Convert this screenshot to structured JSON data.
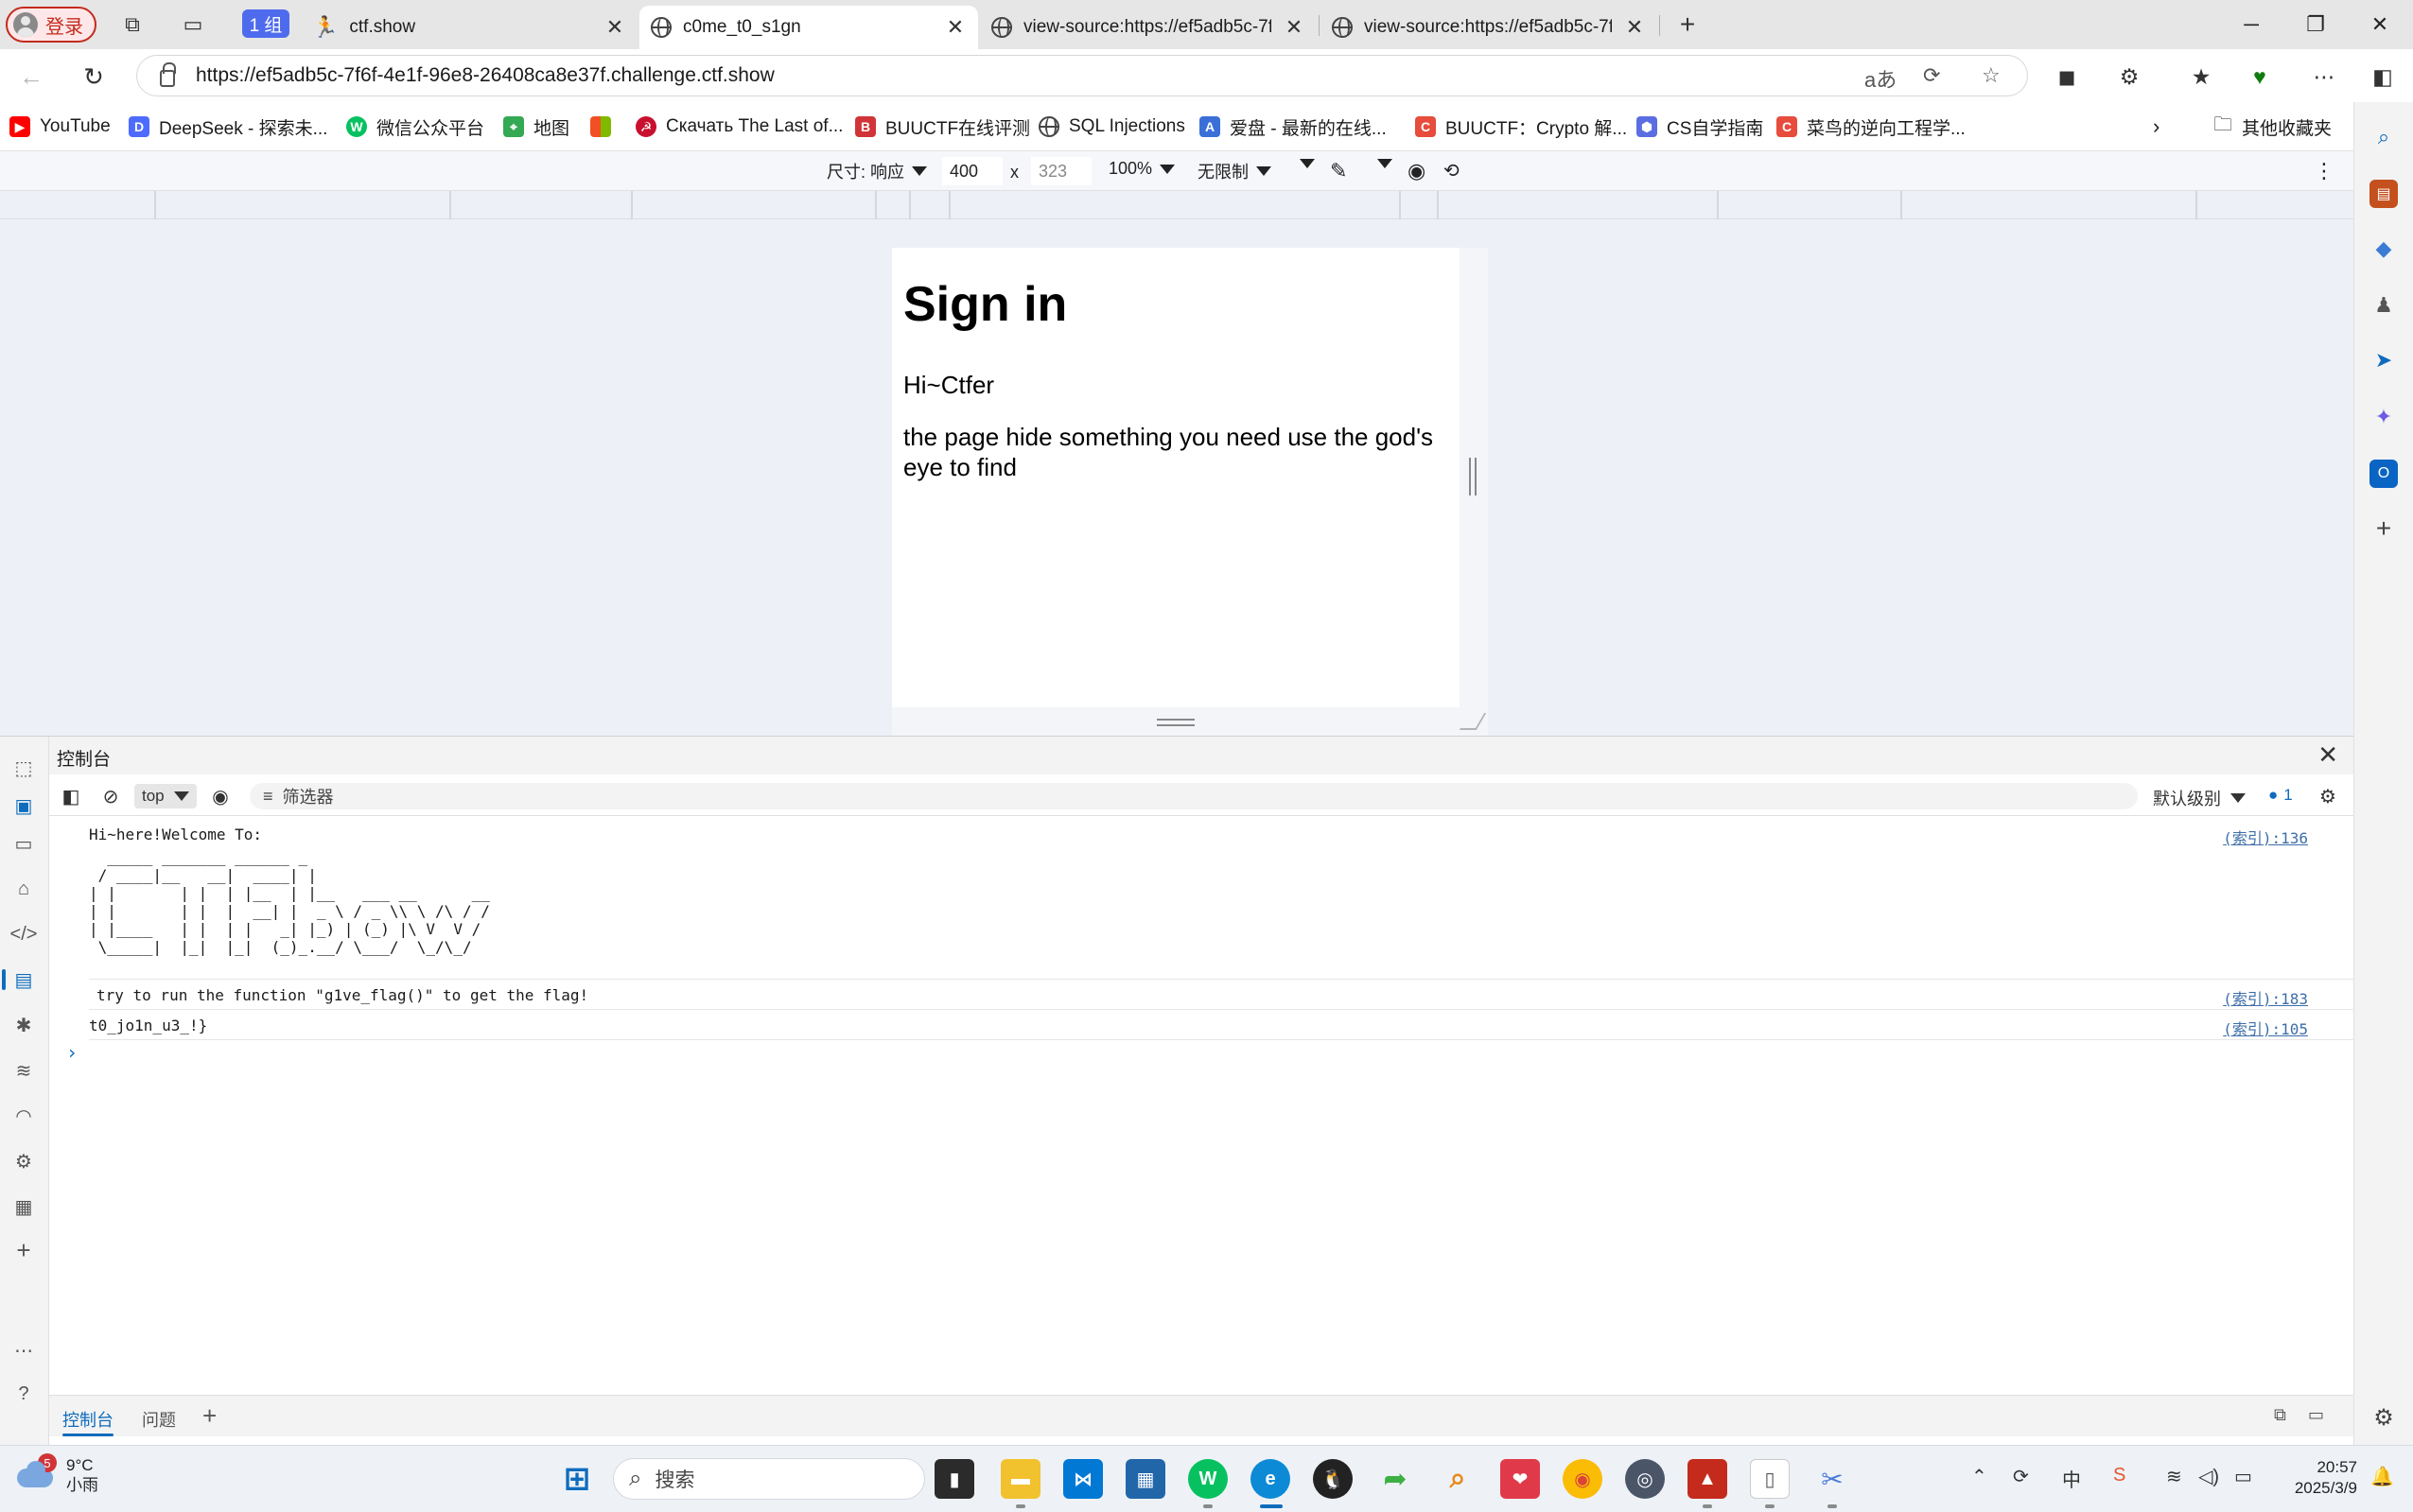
{
  "browser": {
    "profile_label": "登录",
    "group_label": "1 组",
    "tabs": [
      {
        "title": "ctf.show"
      },
      {
        "title": "c0me_t0_s1gn"
      },
      {
        "title": "view-source:https://ef5adb5c-7f6"
      },
      {
        "title": "view-source:https://ef5adb5c-7f6"
      }
    ],
    "url": "https://ef5adb5c-7f6f-4e1f-96e8-26408ca8e37f.challenge.ctf.show",
    "favorites": [
      {
        "label": "YouTube",
        "color": "#ff0000",
        "glyph": "▶"
      },
      {
        "label": "DeepSeek - 探索未...",
        "color": "#4d6bfe",
        "glyph": "D"
      },
      {
        "label": "微信公众平台",
        "color": "#07c160",
        "glyph": "W"
      },
      {
        "label": "地图",
        "color": "#34a853",
        "glyph": "M"
      },
      {
        "label": "",
        "color": "#f25022",
        "glyph": ""
      },
      {
        "label": "Скачать The Last of...",
        "color": "#c8102e",
        "glyph": "☭"
      },
      {
        "label": "BUUCTF在线评测",
        "color": "#d13438",
        "glyph": "B"
      },
      {
        "label": "SQL Injections",
        "color": "#555555",
        "glyph": "⊕"
      },
      {
        "label": "爱盘 - 最新的在线...",
        "color": "#3a6fd8",
        "glyph": "A"
      },
      {
        "label": "BUUCTF：Crypto 解...",
        "color": "#e74c3c",
        "glyph": "C"
      },
      {
        "label": "CS自学指南",
        "color": "#5b6ee1",
        "glyph": "⬢"
      },
      {
        "label": "菜鸟的逆向工程学...",
        "color": "#e74c3c",
        "glyph": "C"
      }
    ],
    "other_favorites": "其他收藏夹"
  },
  "device_toolbar": {
    "size_label": "尺寸: 响应",
    "width": "400",
    "times": "x",
    "height": "323",
    "zoom": "100%",
    "throttle": "无限制"
  },
  "page": {
    "heading": "Sign in",
    "greeting": "Hi~Ctfer",
    "hint": "the page hide something you need use the god's eye to find"
  },
  "devtools": {
    "panel_title": "控制台",
    "context": "top",
    "filter_placeholder": "筛选器",
    "levels": "默认级别",
    "issues_count": "1",
    "messages": [
      {
        "text": "Hi~here!Welcome To:",
        "source": "(索引):136"
      },
      {
        "text": "try to run the function \"g1ve_flag()\" to get the flag!",
        "source": "(索引):183"
      },
      {
        "text": "t0_jo1n_u3_!}",
        "source": "(索引):105"
      }
    ],
    "ascii_art": "  _____ _______ ______ _       \n / ____|__   __|  ____| |      \n| |       | |  | |__  | |__   ___ __      __\n| |       | |  |  __| |  _ \\ / _ \\\\ \\ /\\ / /\n| |____   | |  | |   _| |_) | (_) |\\ V  V / \n \\_____|  |_|  |_|  (_)_.__/ \\___/  \\_/\\_/  ",
    "drawer_tabs": [
      "控制台",
      "问题"
    ]
  },
  "taskbar": {
    "weather_temp": "9°C",
    "weather_desc": "小雨",
    "weather_badge": "5",
    "search_placeholder": "搜索",
    "time": "20:57",
    "date": "2025/3/9"
  }
}
